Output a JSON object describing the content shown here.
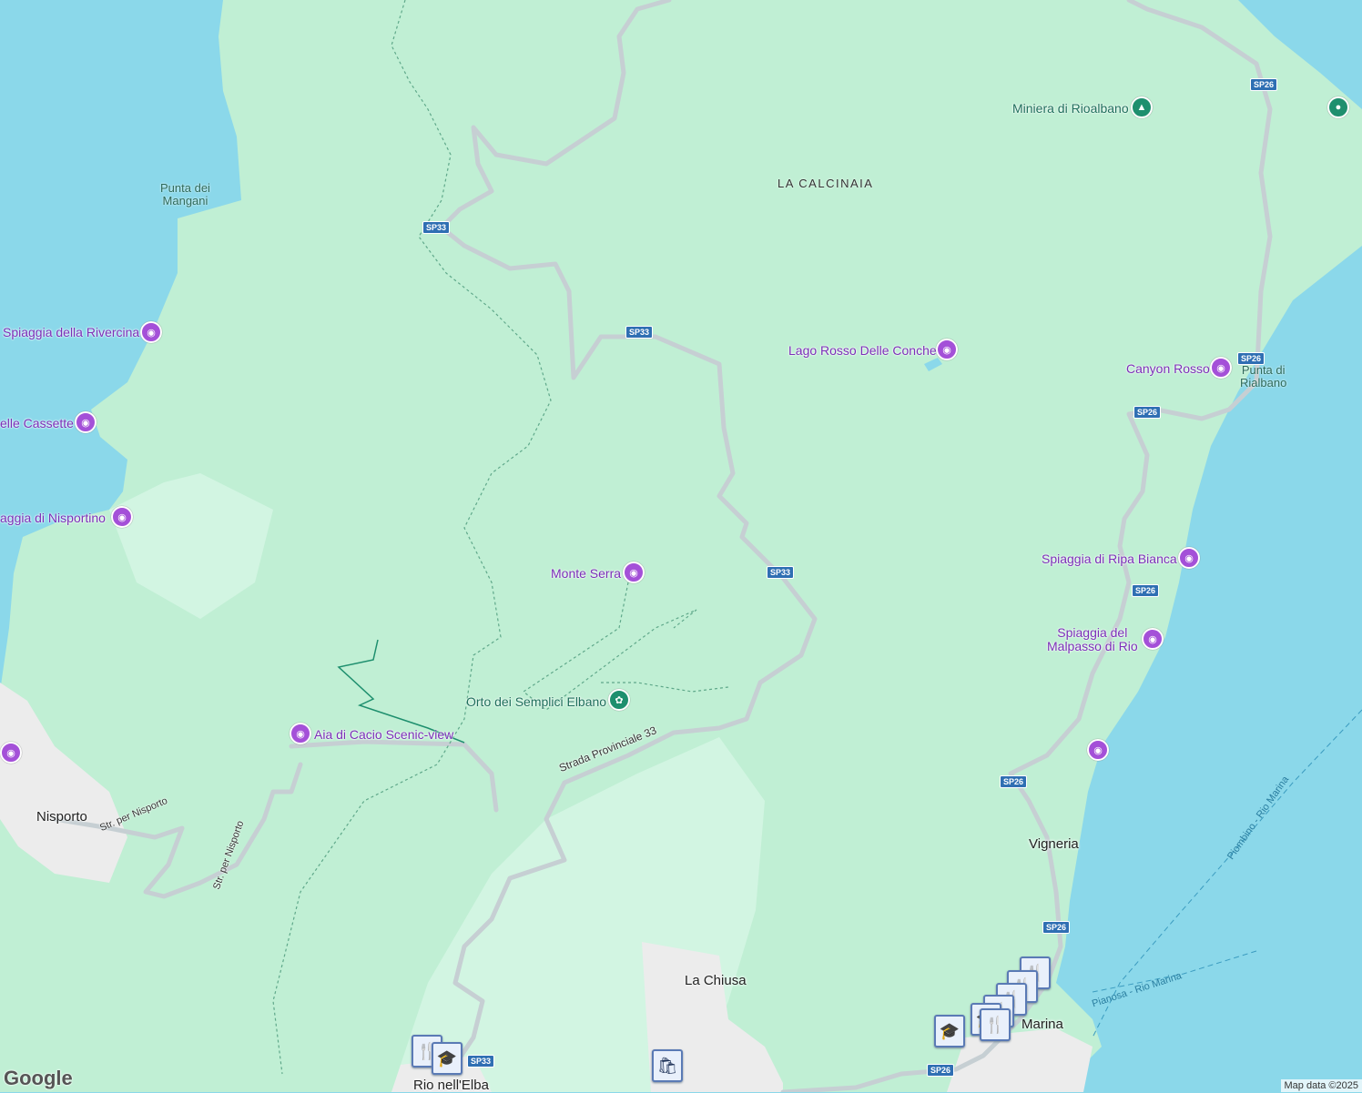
{
  "map": {
    "colors": {
      "sea": "#8bd8ea",
      "land": "#c0efd4",
      "lowland": "#d2f5e2",
      "urban": "#ececec",
      "road": "#c6cfd3",
      "trail": "#5fa88a",
      "poi": "#7b2fb8"
    },
    "places": {
      "nisporto": "Nisporto",
      "vigneria": "Vigneria",
      "la_chiusa": "La Chiusa",
      "rio_nell_elba": "Rio nell'Elba",
      "rio_marina": "Marina"
    },
    "areas": {
      "la_calcinaia": "LA CALCINAIA"
    },
    "natural": {
      "punta_dei_mangani": "Punta dei\nMangani",
      "punta_di_rialbano": "Punta di\nRialbano"
    },
    "pois": {
      "spiaggia_rivercina": "Spiaggia della Rivercina",
      "cassette": "elle Cassette",
      "spiaggia_nisportino": "aggia di Nisportino",
      "monte_serra": "Monte Serra",
      "orto_semplici": "Orto dei Semplici Elbano",
      "aia_di_cacio": "Aia di Cacio Scenic-view",
      "lago_rosso": "Lago Rosso Delle Conche",
      "canyon_rosso": "Canyon Rosso",
      "miniera_rioalbano": "Miniera di Rioalbano",
      "spiaggia_ripa_bianca": "Spiaggia di Ripa Bianca",
      "spiaggia_malpasso": "Spiaggia del\nMalpasso di Rio"
    },
    "roads": {
      "sp33": "SP33",
      "sp26": "SP26",
      "strada_provinciale_33": "Strada Provinciale 33",
      "str_per_nisporto": "Str. per Nisporto"
    },
    "ferries": {
      "piombino_rio_marina": "Piombino - Rio Marina",
      "pianosa_rio_marina": "Pianosa - Rio Marina"
    },
    "icons": {
      "camera": "camera-icon",
      "tree": "tree-icon",
      "flower": "flower-icon",
      "restaurant": "restaurant-icon",
      "school": "school-icon",
      "shopping": "shopping-bag-icon"
    },
    "attribution": "Map data ©2025",
    "logo": "Google"
  }
}
